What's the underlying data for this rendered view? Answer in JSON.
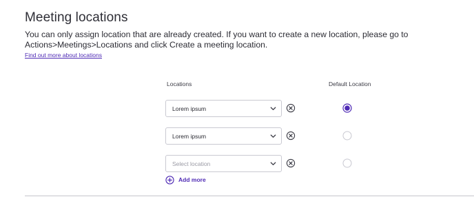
{
  "section": {
    "title": "Meeting locations",
    "description": "You can only assign location that are already created. If you want to create a new location, please go to Actions>Meetings>Locations and click Create a meeting location.",
    "link_label": "Find out more about locations"
  },
  "columns": {
    "locations": "Locations",
    "default": "Default Location"
  },
  "rows": [
    {
      "value": "Lorem ipsum",
      "placeholder": "",
      "is_default": true
    },
    {
      "value": "Lorem ipsum",
      "placeholder": "",
      "is_default": false
    },
    {
      "value": "",
      "placeholder": "Select location",
      "is_default": false
    }
  ],
  "add_more_label": "Add more",
  "icons": {
    "dropdown": "chevron-down-icon",
    "clear": "clear-circle-x-icon",
    "add": "plus-circle-icon"
  },
  "colors": {
    "accent": "#4f2bb5",
    "text": "#2b2b33",
    "border": "#c9c9d1"
  }
}
